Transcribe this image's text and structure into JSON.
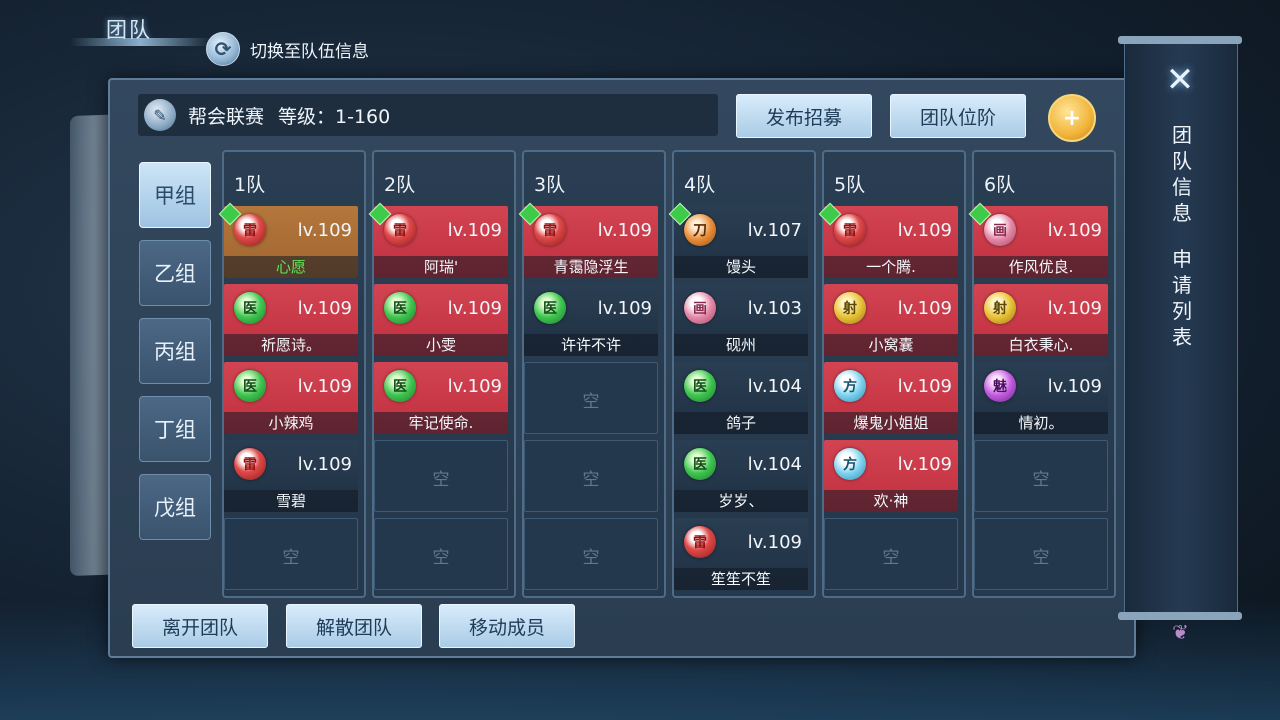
{
  "header": {
    "title": "团队",
    "switch_label": "切换至队伍信息"
  },
  "league": {
    "name": "帮会联赛",
    "level": "等级：1-160"
  },
  "actions": {
    "recruit": "发布招募",
    "rank": "团队位阶"
  },
  "groups": [
    "甲组",
    "乙组",
    "丙组",
    "丁组",
    "戊组"
  ],
  "empty_label": "空",
  "teams": [
    {
      "name": "1队",
      "members": [
        {
          "icon": "rank-red",
          "level": "lv.109",
          "name": "心愿",
          "style": "orange",
          "leader": true
        },
        {
          "icon": "rank-green",
          "level": "lv.109",
          "name": "祈愿诗。",
          "style": "red"
        },
        {
          "icon": "rank-green",
          "level": "lv.109",
          "name": "小辣鸡",
          "style": "red"
        },
        {
          "icon": "rank-red",
          "level": "lv.109",
          "name": "雪碧",
          "style": "dark"
        }
      ]
    },
    {
      "name": "2队",
      "members": [
        {
          "icon": "rank-red",
          "level": "lv.109",
          "name": "阿瑞'",
          "style": "red",
          "leader": true
        },
        {
          "icon": "rank-green",
          "level": "lv.109",
          "name": "小雯",
          "style": "red"
        },
        {
          "icon": "rank-green",
          "level": "lv.109",
          "name": "牢记使命.",
          "style": "red"
        }
      ]
    },
    {
      "name": "3队",
      "members": [
        {
          "icon": "rank-red",
          "level": "lv.109",
          "name": "青霭隐浮生",
          "style": "red",
          "leader": true
        },
        {
          "icon": "rank-green",
          "level": "lv.109",
          "name": "许许不许",
          "style": "dark"
        }
      ]
    },
    {
      "name": "4队",
      "members": [
        {
          "icon": "rank-orange",
          "level": "lv.107",
          "name": "馒头",
          "style": "dark",
          "leader": true
        },
        {
          "icon": "rank-pink",
          "level": "lv.103",
          "name": "砚州",
          "style": "dark"
        },
        {
          "icon": "rank-green",
          "level": "lv.104",
          "name": "鸽子",
          "style": "dark"
        },
        {
          "icon": "rank-green",
          "level": "lv.104",
          "name": "岁岁、",
          "style": "dark"
        },
        {
          "icon": "rank-red",
          "level": "lv.109",
          "name": "笙笙不笙",
          "style": "dark"
        }
      ]
    },
    {
      "name": "5队",
      "members": [
        {
          "icon": "rank-red",
          "level": "lv.109",
          "name": "一个腾.",
          "style": "red",
          "leader": true
        },
        {
          "icon": "rank-yellow",
          "level": "lv.109",
          "name": "小窝囊",
          "style": "red"
        },
        {
          "icon": "rank-cyan",
          "level": "lv.109",
          "name": "爆鬼小姐姐",
          "style": "red"
        },
        {
          "icon": "rank-cyan",
          "level": "lv.109",
          "name": "欢·神",
          "style": "red"
        }
      ]
    },
    {
      "name": "6队",
      "members": [
        {
          "icon": "rank-pink",
          "level": "lv.109",
          "name": "作风优良.",
          "style": "red",
          "leader": true
        },
        {
          "icon": "rank-yellow",
          "level": "lv.109",
          "name": "白衣秉心.",
          "style": "red"
        },
        {
          "icon": "rank-purple",
          "level": "lv.109",
          "name": "情初。",
          "style": "dark"
        }
      ]
    }
  ],
  "bottom": {
    "leave": "离开团队",
    "disband": "解散团队",
    "move": "移动成员"
  },
  "side_tabs": [
    "团队信息",
    "申请列表"
  ]
}
